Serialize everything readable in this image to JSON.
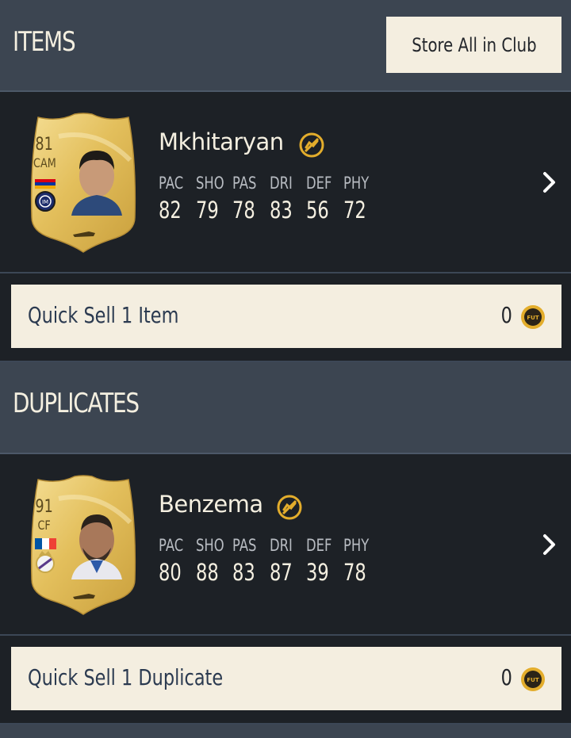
{
  "items_section": {
    "title": "ITEMS",
    "store_button_label": "Store All in Club"
  },
  "items": [
    {
      "rating": "81",
      "position": "CAM",
      "name": "Mkhitaryan",
      "flag": "armenia",
      "club_badge": "inter-badge",
      "stat_labels": [
        "PAC",
        "SHO",
        "PAS",
        "DRI",
        "DEF",
        "PHY"
      ],
      "stat_values": [
        "82",
        "79",
        "78",
        "83",
        "56",
        "72"
      ]
    }
  ],
  "quick_sell_items": {
    "label": "Quick Sell 1 Item",
    "value": "0"
  },
  "duplicates_section": {
    "title": "DUPLICATES"
  },
  "duplicates": [
    {
      "rating": "91",
      "position": "CF",
      "name": "Benzema",
      "flag": "france",
      "club_badge": "real-madrid-badge",
      "stat_labels": [
        "PAC",
        "SHO",
        "PAS",
        "DRI",
        "DEF",
        "PHY"
      ],
      "stat_values": [
        "80",
        "88",
        "83",
        "87",
        "39",
        "78"
      ]
    }
  ],
  "quick_sell_duplicates": {
    "label": "Quick Sell 1 Duplicate",
    "value": "0"
  },
  "colors": {
    "background": "#1d2126",
    "header": "#3c4551",
    "button": "#f4eee0",
    "gold": "#e8c25a",
    "untradeable": "#e3ad2c"
  },
  "icons": {
    "untradeable": "untradeable-icon",
    "chevron": "chevron-right-icon",
    "coin": "fut-coin-icon",
    "boot": "boot-icon"
  }
}
